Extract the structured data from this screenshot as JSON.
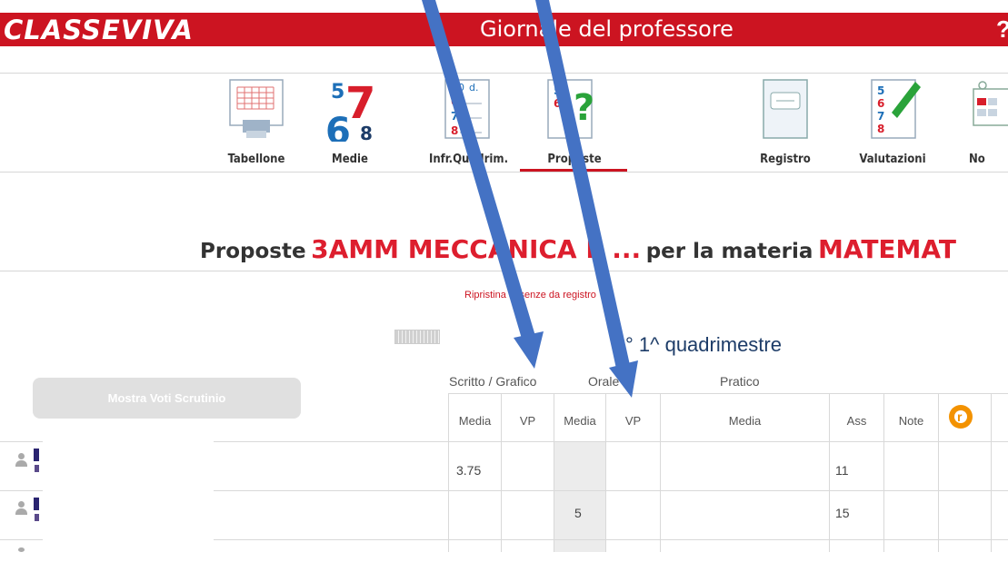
{
  "header": {
    "brand": "CLASSEVIVA",
    "app_title": "Giornale del professore",
    "help_glyph": "?"
  },
  "toolbar": {
    "items": [
      {
        "label": "Tabellone",
        "icon": "grid-sheet-icon"
      },
      {
        "label": "Medie",
        "icon": "numbers-678-icon"
      },
      {
        "label": "Infr.Quadrim.",
        "icon": "notebook-grades-icon"
      },
      {
        "label": "Proposte",
        "icon": "notebook-question-icon",
        "active": true
      },
      {
        "label": "Registro",
        "icon": "register-book-icon"
      },
      {
        "label": "Valutazioni",
        "icon": "notebook-pen-icon"
      },
      {
        "label": "No",
        "icon": "calendar-icon"
      }
    ]
  },
  "page": {
    "heading_prefix": "Proposte",
    "class_name": "3AMM MECCANICA E ...",
    "heading_mid": "per la materia",
    "subject": "MATEMAT",
    "restore_link": "Ripristina assenze da registro",
    "period": "° 1^ quadrimestre",
    "show_votes_button": "Mostra Voti Scrutinio"
  },
  "table": {
    "groups": [
      "Scritto / Grafico",
      "Orale",
      "Pratico"
    ],
    "columns": [
      "Media",
      "VP",
      "Media",
      "VP",
      "Media",
      "Ass",
      "Note"
    ],
    "rows": [
      {
        "scritto_media": "3.75",
        "scritto_vp": "",
        "orale_media": "",
        "orale_vp": "",
        "pratico_media": "",
        "ass": "11",
        "note": ""
      },
      {
        "scritto_media": "",
        "scritto_vp": "",
        "orale_media": "5",
        "orale_vp": "",
        "pratico_media": "",
        "ass": "15",
        "note": ""
      }
    ]
  },
  "colors": {
    "brand_red": "#cc1421",
    "heading_red": "#dd1e2e",
    "period_blue": "#1d3c68",
    "annotation_arrow": "#4472c4"
  }
}
